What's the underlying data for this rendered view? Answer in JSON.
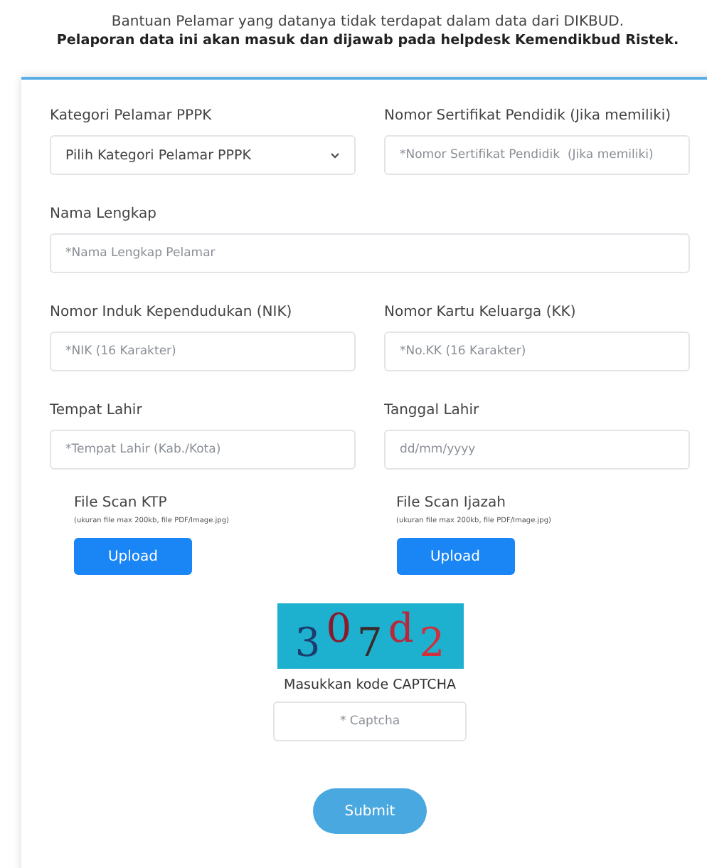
{
  "intro": {
    "line": "Bantuan Pelamar yang datanya tidak terdapat dalam data dari DIKBUD.",
    "note": "Pelaporan data ini akan masuk dan dijawab pada helpdesk Kemendikbud Ristek."
  },
  "rows": [
    {
      "fields": [
        {
          "kind": "select",
          "label": "Kategori Pelamar PPPK",
          "value": "Pilih Kategori Pelamar PPPK"
        },
        {
          "kind": "input",
          "label": "Nomor Sertifikat Pendidik (Jika memiliki)",
          "placeholder": "*Nomor Sertifikat Pendidik  (Jika memiliki)"
        }
      ]
    },
    {
      "fields": [
        {
          "kind": "input",
          "label": "Nama Lengkap",
          "placeholder": "*Nama Lengkap Pelamar"
        }
      ]
    },
    {
      "fields": [
        {
          "kind": "input",
          "label": "Nomor Induk Kependudukan (NIK)",
          "placeholder": "*NIK (16 Karakter)"
        },
        {
          "kind": "input",
          "label": "Nomor Kartu Keluarga (KK)",
          "placeholder": "*No.KK (16 Karakter)"
        }
      ]
    },
    {
      "fields": [
        {
          "kind": "input",
          "label": "Tempat Lahir",
          "placeholder": "*Tempat Lahir (Kab./Kota)"
        },
        {
          "kind": "input",
          "label": "Tanggal Lahir",
          "placeholder": "dd/mm/yyyy"
        }
      ]
    }
  ],
  "uploads": [
    {
      "label": "File Scan KTP",
      "hint": "(ukuran file max 200kb, file PDF/Image.jpg)",
      "button": "Upload"
    },
    {
      "label": "File Scan Ijazah",
      "hint": "(ukuran file max 200kb, file PDF/Image.jpg)",
      "button": "Upload"
    }
  ],
  "captcha": {
    "chars": [
      {
        "text": "3",
        "color": "#1d3c6e"
      },
      {
        "text": "0",
        "color": "#8a1a2a"
      },
      {
        "text": "7",
        "color": "#3a2a2a"
      },
      {
        "text": "d",
        "color": "#b8283a"
      },
      {
        "text": "2",
        "color": "#d0303c"
      }
    ],
    "caption": "Masukkan kode CAPTCHA",
    "placeholder": "* Captcha"
  },
  "submit": "Submit"
}
